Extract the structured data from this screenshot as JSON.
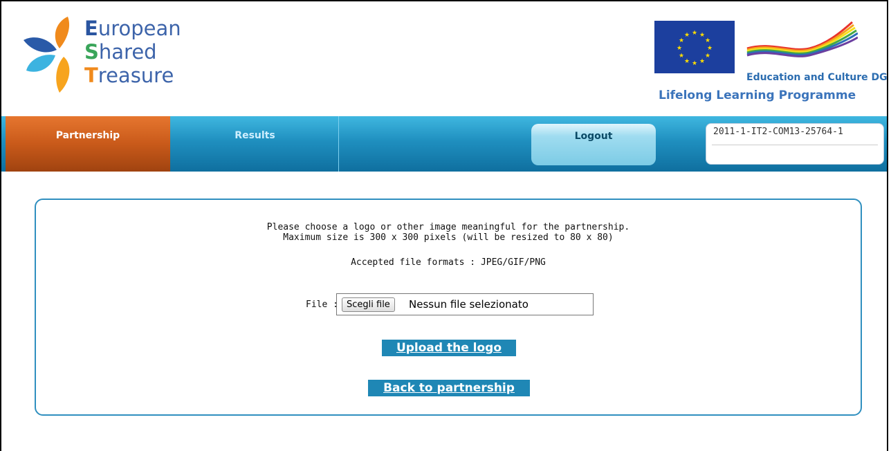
{
  "header": {
    "logo": {
      "word1_initial": "E",
      "word1_rest": "uropean",
      "word2_initial": "S",
      "word2_rest": "hared",
      "word3_initial": "T",
      "word3_rest": "reasure"
    },
    "eu": {
      "program_dg": "Education and Culture DG",
      "programme_name": "Lifelong Learning Programme"
    }
  },
  "nav": {
    "tabs": [
      {
        "label": "Partnership",
        "active": true
      },
      {
        "label": "Results",
        "active": false
      }
    ],
    "logout_label": "Logout",
    "project_code": "2011-1-IT2-COM13-25764-1"
  },
  "upload": {
    "instruction_line1": "Please choose a logo or other image meaningful for the partnership.",
    "instruction_line2": "Maximum size is 300 x 300 pixels (will be resized to 80 x 80)",
    "formats_text": "Accepted file formats : JPEG/GIF/PNG",
    "file_label": "File :",
    "choose_button": "Scegli file",
    "no_file_text": "Nessun file selezionato",
    "upload_button": "Upload the logo",
    "back_button": "Back to partnership"
  },
  "colors": {
    "primary_blue": "#1f87b5",
    "active_tab_orange": "#c95a1a",
    "panel_border": "#2f8fbf"
  }
}
